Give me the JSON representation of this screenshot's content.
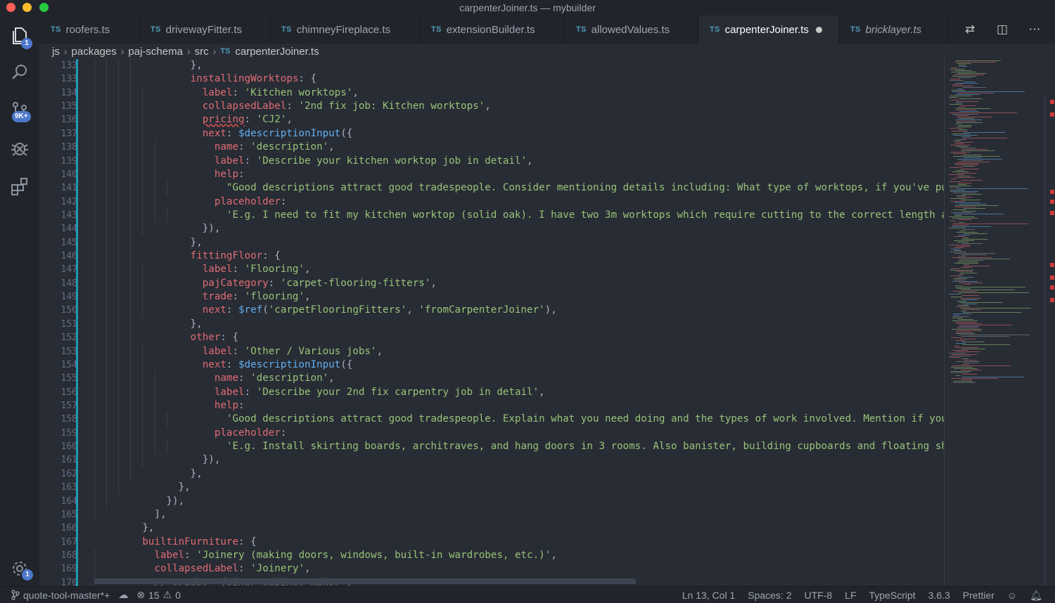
{
  "window": {
    "title": "carpenterJoiner.ts — mybuilder"
  },
  "activity": {
    "explorer_badge": "1",
    "scm_badge": "9K+",
    "settings_badge": "1"
  },
  "tabs": [
    {
      "lang": "TS",
      "label": "roofers.ts"
    },
    {
      "lang": "TS",
      "label": "drivewayFitter.ts"
    },
    {
      "lang": "TS",
      "label": "chimneyFireplace.ts"
    },
    {
      "lang": "TS",
      "label": "extensionBuilder.ts"
    },
    {
      "lang": "TS",
      "label": "allowedValues.ts"
    },
    {
      "lang": "TS",
      "label": "carpenterJoiner.ts"
    },
    {
      "lang": "TS",
      "label": "bricklayer.ts"
    }
  ],
  "breadcrumb": {
    "items": [
      "js",
      "packages",
      "paj-schema",
      "src"
    ],
    "file_lang": "TS",
    "file": "carpenterJoiner.ts"
  },
  "editor": {
    "line_numbers": [
      "132",
      "133",
      "134",
      "135",
      "136",
      "137",
      "138",
      "139",
      "140",
      "141",
      "142",
      "143",
      "144",
      "145",
      "146",
      "147",
      "148",
      "149",
      "150",
      "151",
      "152",
      "153",
      "154",
      "155",
      "156",
      "157",
      "158",
      "159",
      "160",
      "161",
      "162",
      "163",
      "164",
      "165",
      "166",
      "167",
      "168",
      "169",
      "170"
    ]
  },
  "statusbar": {
    "branch": "quote-tool-master*+",
    "errors": "15",
    "warnings": "0",
    "position": "Ln 13, Col 1",
    "spaces": "Spaces: 2",
    "encoding": "UTF-8",
    "eol": "LF",
    "language": "TypeScript",
    "version": "3.6.3",
    "formatter": "Prettier"
  },
  "colors": {
    "keyword": "#e06c75",
    "string": "#98c379",
    "function": "#61afef",
    "accent": "#1f9ab5",
    "badge": "#4d78cc"
  }
}
